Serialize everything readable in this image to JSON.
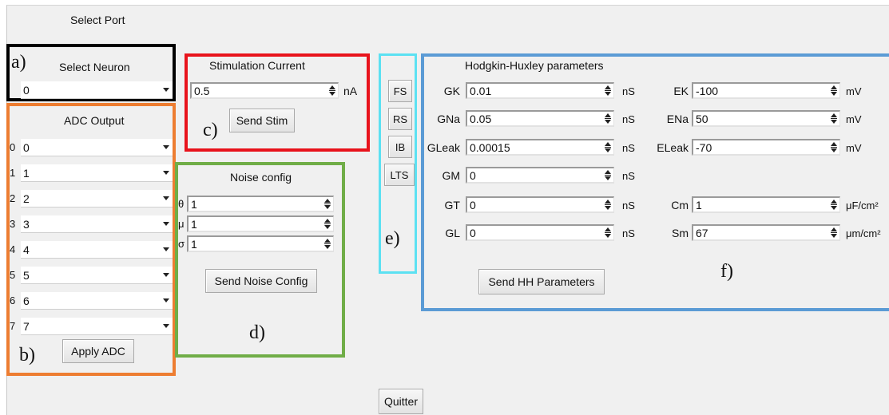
{
  "window": {
    "select_port": "Select Port",
    "quit_label": "Quitter"
  },
  "neuron": {
    "tag": "a)",
    "title": "Select Neuron",
    "selected": "0"
  },
  "adc": {
    "tag": "b)",
    "title": "ADC Output",
    "apply_label": "Apply ADC",
    "rows": [
      {
        "index": "0",
        "value": "0"
      },
      {
        "index": "1",
        "value": "1"
      },
      {
        "index": "2",
        "value": "2"
      },
      {
        "index": "3",
        "value": "3"
      },
      {
        "index": "4",
        "value": "4"
      },
      {
        "index": "5",
        "value": "5"
      },
      {
        "index": "6",
        "value": "6"
      },
      {
        "index": "7",
        "value": "7"
      }
    ]
  },
  "stim": {
    "tag": "c)",
    "title": "Stimulation Current",
    "value": "0.5",
    "unit": "nA",
    "send_label": "Send Stim"
  },
  "noise": {
    "tag": "d)",
    "title": "Noise config",
    "send_label": "Send Noise Config",
    "params": [
      {
        "symbol": "θ",
        "value": "1"
      },
      {
        "symbol": "μ",
        "value": "1"
      },
      {
        "symbol": "σ",
        "value": "1"
      }
    ]
  },
  "presets": {
    "tag": "e)",
    "buttons": [
      "FS",
      "RS",
      "IB",
      "LTS"
    ]
  },
  "hh": {
    "tag": "f)",
    "title": "Hodgkin-Huxley parameters",
    "send_label": "Send HH Parameters",
    "left": [
      {
        "label": "GK",
        "value": "0.01",
        "unit": "nS"
      },
      {
        "label": "GNa",
        "value": "0.05",
        "unit": "nS"
      },
      {
        "label": "GLeak",
        "value": "0.00015",
        "unit": "nS"
      },
      {
        "label": "GM",
        "value": "0",
        "unit": "nS"
      },
      {
        "label": "GT",
        "value": "0",
        "unit": "nS"
      },
      {
        "label": "GL",
        "value": "0",
        "unit": "nS"
      }
    ],
    "right": [
      {
        "label": "EK",
        "value": "-100",
        "unit": "mV"
      },
      {
        "label": "ENa",
        "value": "50",
        "unit": "mV"
      },
      {
        "label": "ELeak",
        "value": "-70",
        "unit": "mV"
      },
      {
        "label": "Cm",
        "value": "1",
        "unit": "μF/cm²"
      },
      {
        "label": "Sm",
        "value": "67",
        "unit": "μm/cm²"
      }
    ]
  },
  "colors": {
    "black": "#000000",
    "orange": "#ed7d31",
    "red": "#e8131c",
    "green": "#70ad47",
    "cyan": "#5ce1f2",
    "blue": "#5b9bd5"
  }
}
